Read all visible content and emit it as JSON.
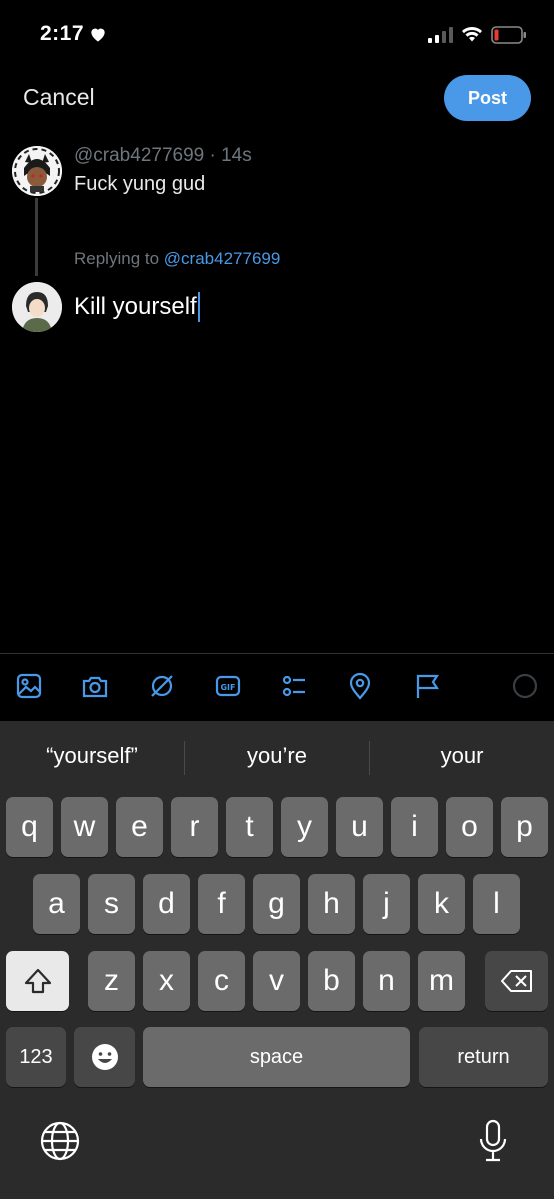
{
  "status": {
    "time": "2:17"
  },
  "header": {
    "cancel_label": "Cancel",
    "post_label": "Post"
  },
  "thread": {
    "original": {
      "handle": "@crab4277699",
      "age": "14s",
      "text": "Fuck yung gud"
    },
    "reply": {
      "replying_prefix": "Replying to",
      "replying_handle": "@crab4277699",
      "draft_text": "Kill yourself"
    }
  },
  "toolbar": {
    "icons": [
      "image-icon",
      "camera-icon",
      "sparkle-icon",
      "gif-icon",
      "poll-icon",
      "location-icon",
      "flag-icon",
      "progress-ring-icon"
    ]
  },
  "keyboard": {
    "suggestions": [
      "“yourself”",
      "you’re",
      "your"
    ],
    "row1": [
      "q",
      "w",
      "e",
      "r",
      "t",
      "y",
      "u",
      "i",
      "o",
      "p"
    ],
    "row2": [
      "a",
      "s",
      "d",
      "f",
      "g",
      "h",
      "j",
      "k",
      "l"
    ],
    "row3": [
      "z",
      "x",
      "c",
      "v",
      "b",
      "n",
      "m"
    ],
    "numbers_label": "123",
    "space_label": "space",
    "return_label": "return"
  },
  "colors": {
    "accent": "#4a99e9",
    "background": "#000000",
    "keyboard_bg": "#2b2b2b",
    "key_bg": "#6b6b6b"
  }
}
